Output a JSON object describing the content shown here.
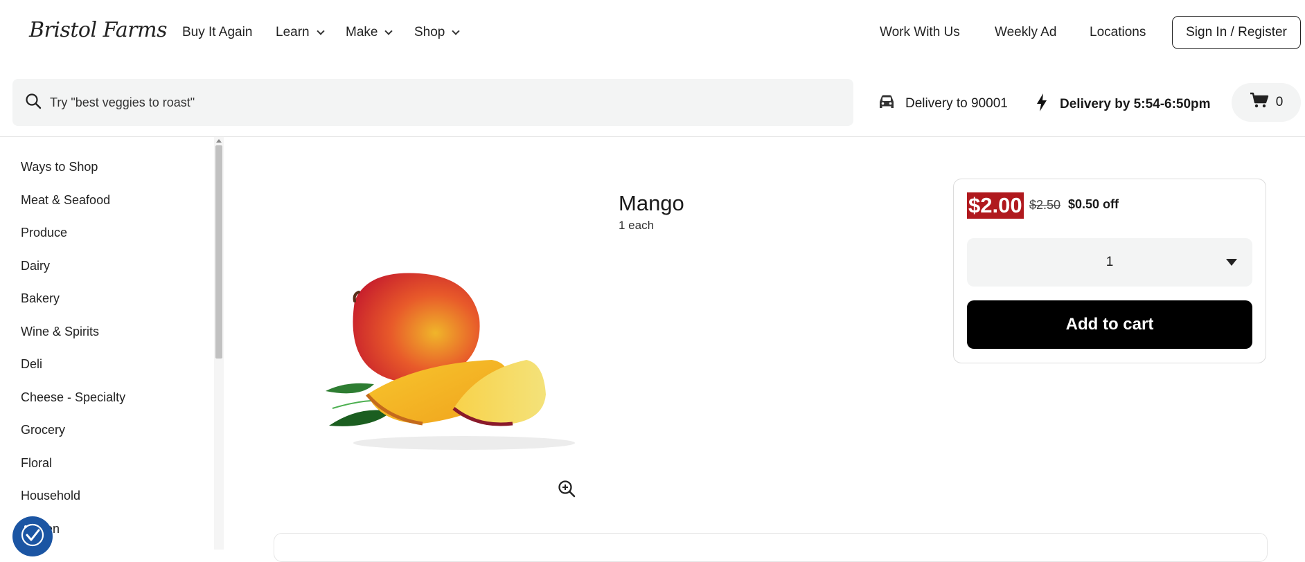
{
  "brand": {
    "logo": "Bristol Farms"
  },
  "nav": {
    "left": [
      {
        "label": "Buy It Again",
        "dropdown": false
      },
      {
        "label": "Learn",
        "dropdown": true
      },
      {
        "label": "Make",
        "dropdown": true
      },
      {
        "label": "Shop",
        "dropdown": true
      }
    ],
    "right": [
      "Work With Us",
      "Weekly Ad",
      "Locations"
    ],
    "signin": "Sign In / Register"
  },
  "search": {
    "placeholder": "Try \"best veggies to roast\""
  },
  "delivery": {
    "zip_text": "Delivery to 90001",
    "time_text": "Delivery by 5:54-6:50pm"
  },
  "cart": {
    "count": "0"
  },
  "sidebar": {
    "items": [
      "Ways to Shop",
      "Meat & Seafood",
      "Produce",
      "Dairy",
      "Bakery",
      "Wine & Spirits",
      "Deli",
      "Cheese - Specialty",
      "Grocery",
      "Floral",
      "Household",
      "Frozen"
    ]
  },
  "product": {
    "title": "Mango",
    "size": "1 each",
    "price_now": "$2.00",
    "price_was": "$2.50",
    "discount": "$0.50 off",
    "quantity": "1",
    "add_to_cart": "Add to cart"
  },
  "colors": {
    "sale_red": "#b0191e",
    "accessibility_blue": "#1b55a3"
  },
  "icons": [
    "search-icon",
    "car-icon",
    "lightning-icon",
    "cart-icon",
    "zoom-in-icon",
    "accessibility-icon",
    "chevron-down-icon",
    "caret-down-icon"
  ]
}
